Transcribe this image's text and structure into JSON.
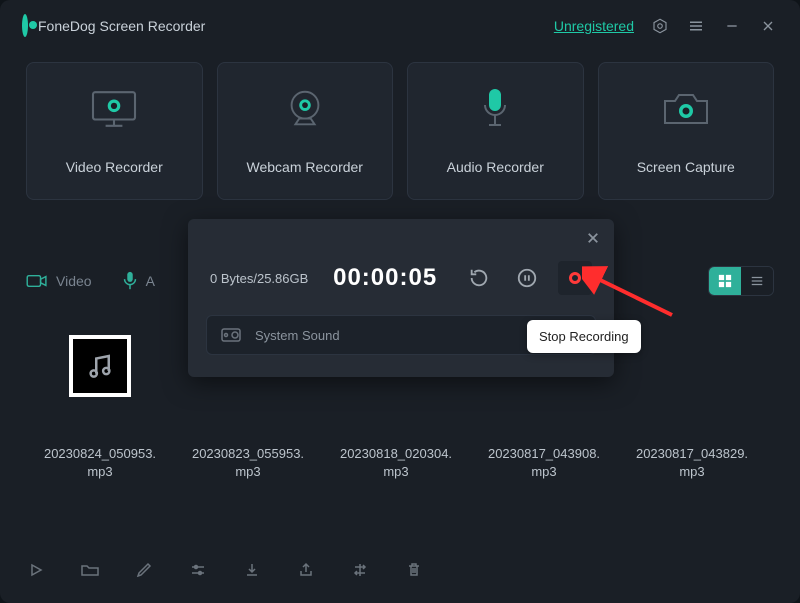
{
  "app": {
    "title": "FoneDog Screen Recorder",
    "unregistered": "Unregistered"
  },
  "cards": {
    "video": "Video Recorder",
    "webcam": "Webcam Recorder",
    "audio": "Audio Recorder",
    "screen": "Screen Capture"
  },
  "tabs": {
    "video": "Video",
    "audio": "A"
  },
  "files": [
    {
      "name": "20230824_050953.mp3"
    },
    {
      "name": "20230823_055953.mp3"
    },
    {
      "name": "20230818_020304.mp3"
    },
    {
      "name": "20230817_043908.mp3"
    },
    {
      "name": "20230817_043829.mp3"
    }
  ],
  "rec": {
    "bytes": "0 Bytes/25.86GB",
    "timer": "00:00:05",
    "source": "System Sound",
    "tooltip": "Stop Recording"
  },
  "colors": {
    "accent": "#1fc9a6",
    "stop": "#ff3a3a"
  }
}
